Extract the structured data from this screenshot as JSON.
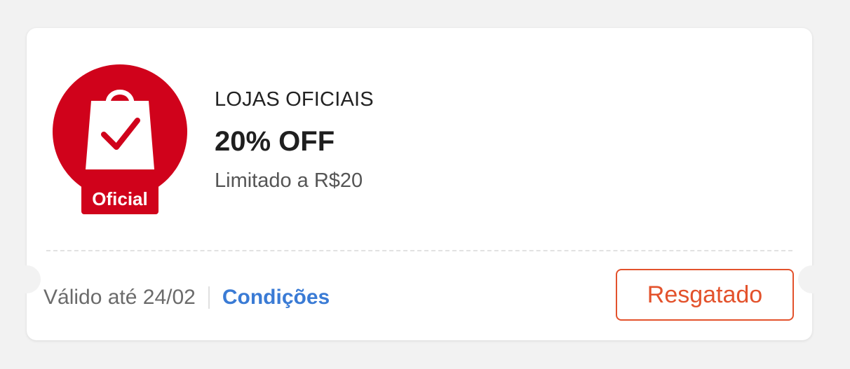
{
  "coupon": {
    "badge": {
      "icon": "official-store-bag-icon",
      "label": "Oficial",
      "color": "#d0021b"
    },
    "category": "LOJAS OFICIAIS",
    "discount": "20% OFF",
    "limit": "Limitado a R$20",
    "validity": "Válido até 24/02",
    "conditions_link": "Condições",
    "action_button": "Resgatado",
    "colors": {
      "accent": "#e3522c",
      "link": "#3a7bd5",
      "badge_red": "#d0021b"
    }
  }
}
